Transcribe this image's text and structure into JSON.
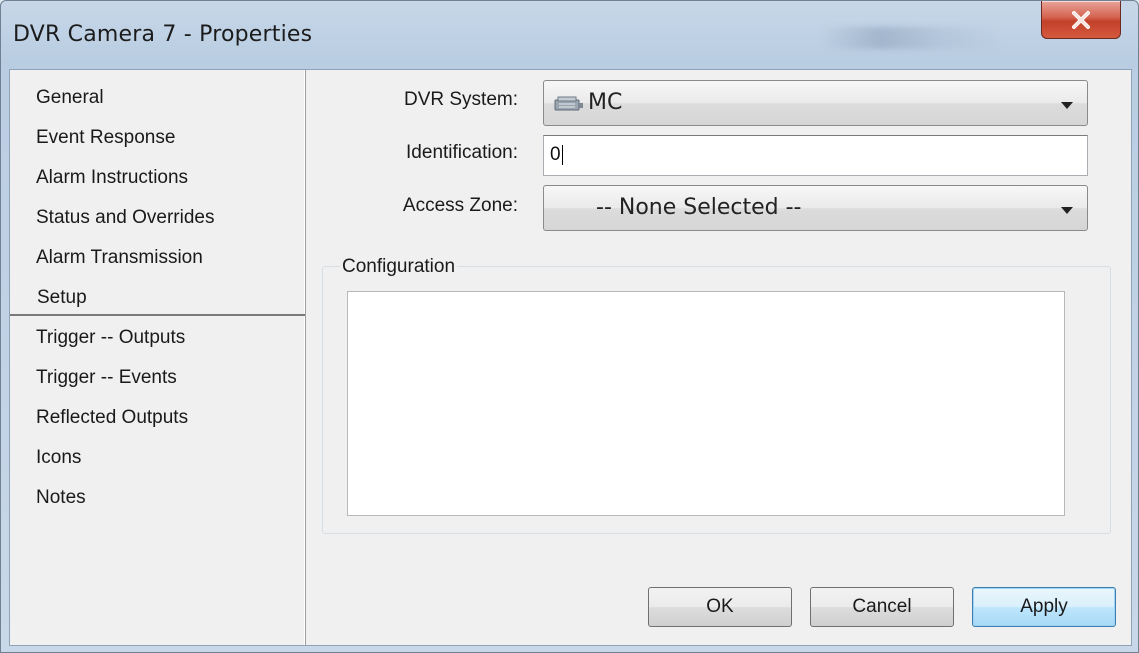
{
  "window": {
    "title": "DVR Camera 7 - Properties"
  },
  "sidebar": {
    "items": [
      {
        "label": "General"
      },
      {
        "label": "Event Response"
      },
      {
        "label": "Alarm Instructions"
      },
      {
        "label": "Status and Overrides"
      },
      {
        "label": "Alarm Transmission"
      },
      {
        "label": "Setup",
        "selected": true
      },
      {
        "label": "Trigger -- Outputs"
      },
      {
        "label": "Trigger -- Events"
      },
      {
        "label": "Reflected Outputs"
      },
      {
        "label": "Icons"
      },
      {
        "label": "Notes"
      }
    ]
  },
  "form": {
    "dvr_system_label": "DVR System:",
    "dvr_system_value": "MC",
    "dvr_system_icon": "dvr-device-icon",
    "identification_label": "Identification:",
    "identification_value": "0",
    "access_zone_label": "Access Zone:",
    "access_zone_value": "-- None Selected --"
  },
  "configuration": {
    "title": "Configuration"
  },
  "buttons": {
    "ok": "OK",
    "cancel": "Cancel",
    "apply": "Apply"
  },
  "colors": {
    "close_button": "#c9442e",
    "default_button_border": "#3c7fb1"
  }
}
